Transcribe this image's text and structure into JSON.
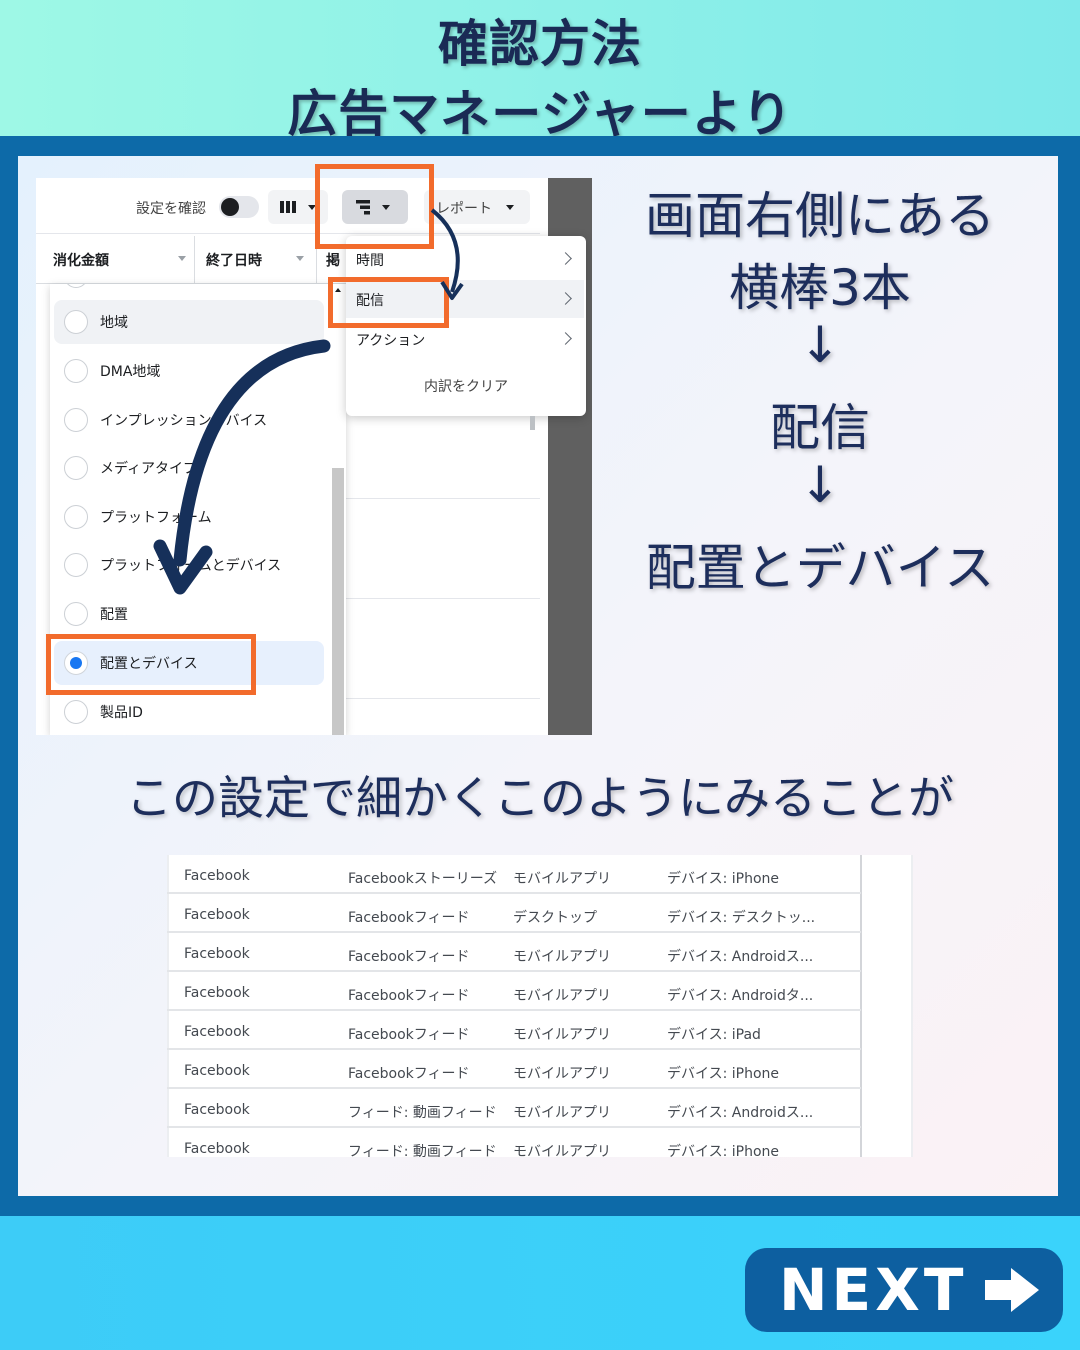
{
  "header": {
    "title_line1": "確認方法",
    "title_line2": "広告マネージャーより"
  },
  "screenshot": {
    "toolbar": {
      "confirm_label": "設定を確認",
      "report_label": "レポート"
    },
    "table_headers": [
      "消化金額",
      "終了日時",
      "掲"
    ],
    "breakdown_options": [
      {
        "label": "地域",
        "selected": false
      },
      {
        "label": "DMA地域",
        "selected": false
      },
      {
        "label": "インプレッションデバイス",
        "selected": false
      },
      {
        "label": "メディアタイプ",
        "selected": false
      },
      {
        "label": "プラットフォーム",
        "selected": false
      },
      {
        "label": "プラットフォームとデバイス",
        "selected": false
      },
      {
        "label": "配置",
        "selected": false
      },
      {
        "label": "配置とデバイス",
        "selected": true
      },
      {
        "label": "製品ID",
        "selected": false
      }
    ],
    "breakdown_menu": {
      "time": "時間",
      "delivery": "配信",
      "action": "アクション",
      "clear": "内訳をクリア"
    }
  },
  "instructions": {
    "line1": "画面右側にある",
    "line2": "横棒3本",
    "arrow1": "↓",
    "step2": "配信",
    "arrow2": "↓",
    "step3": "配置とデバイス"
  },
  "caption": "この設定で細かくこのようにみることが",
  "results_table": [
    [
      "Facebook",
      "Facebookストーリーズ",
      "モバイルアプリ",
      "デバイス: iPhone"
    ],
    [
      "Facebook",
      "Facebookフィード",
      "デスクトップ",
      "デバイス: デスクトッ..."
    ],
    [
      "Facebook",
      "Facebookフィード",
      "モバイルアプリ",
      "デバイス: Androidス..."
    ],
    [
      "Facebook",
      "Facebookフィード",
      "モバイルアプリ",
      "デバイス: Androidタ..."
    ],
    [
      "Facebook",
      "Facebookフィード",
      "モバイルアプリ",
      "デバイス: iPad"
    ],
    [
      "Facebook",
      "Facebookフィード",
      "モバイルアプリ",
      "デバイス: iPhone"
    ],
    [
      "Facebook",
      "フィード: 動画フィード",
      "モバイルアプリ",
      "デバイス: Androidス..."
    ],
    [
      "Facebook",
      "フィード: 動画フィード",
      "モバイルアプリ",
      "デバイス: iPhone"
    ]
  ],
  "next_button": {
    "label": "NEXT"
  },
  "colors": {
    "highlight": "#f26b2c",
    "frame": "#0d6aa8",
    "button": "#0d5fa0",
    "text_dark": "#1d2e5c",
    "radio_selected": "#1877f2"
  }
}
